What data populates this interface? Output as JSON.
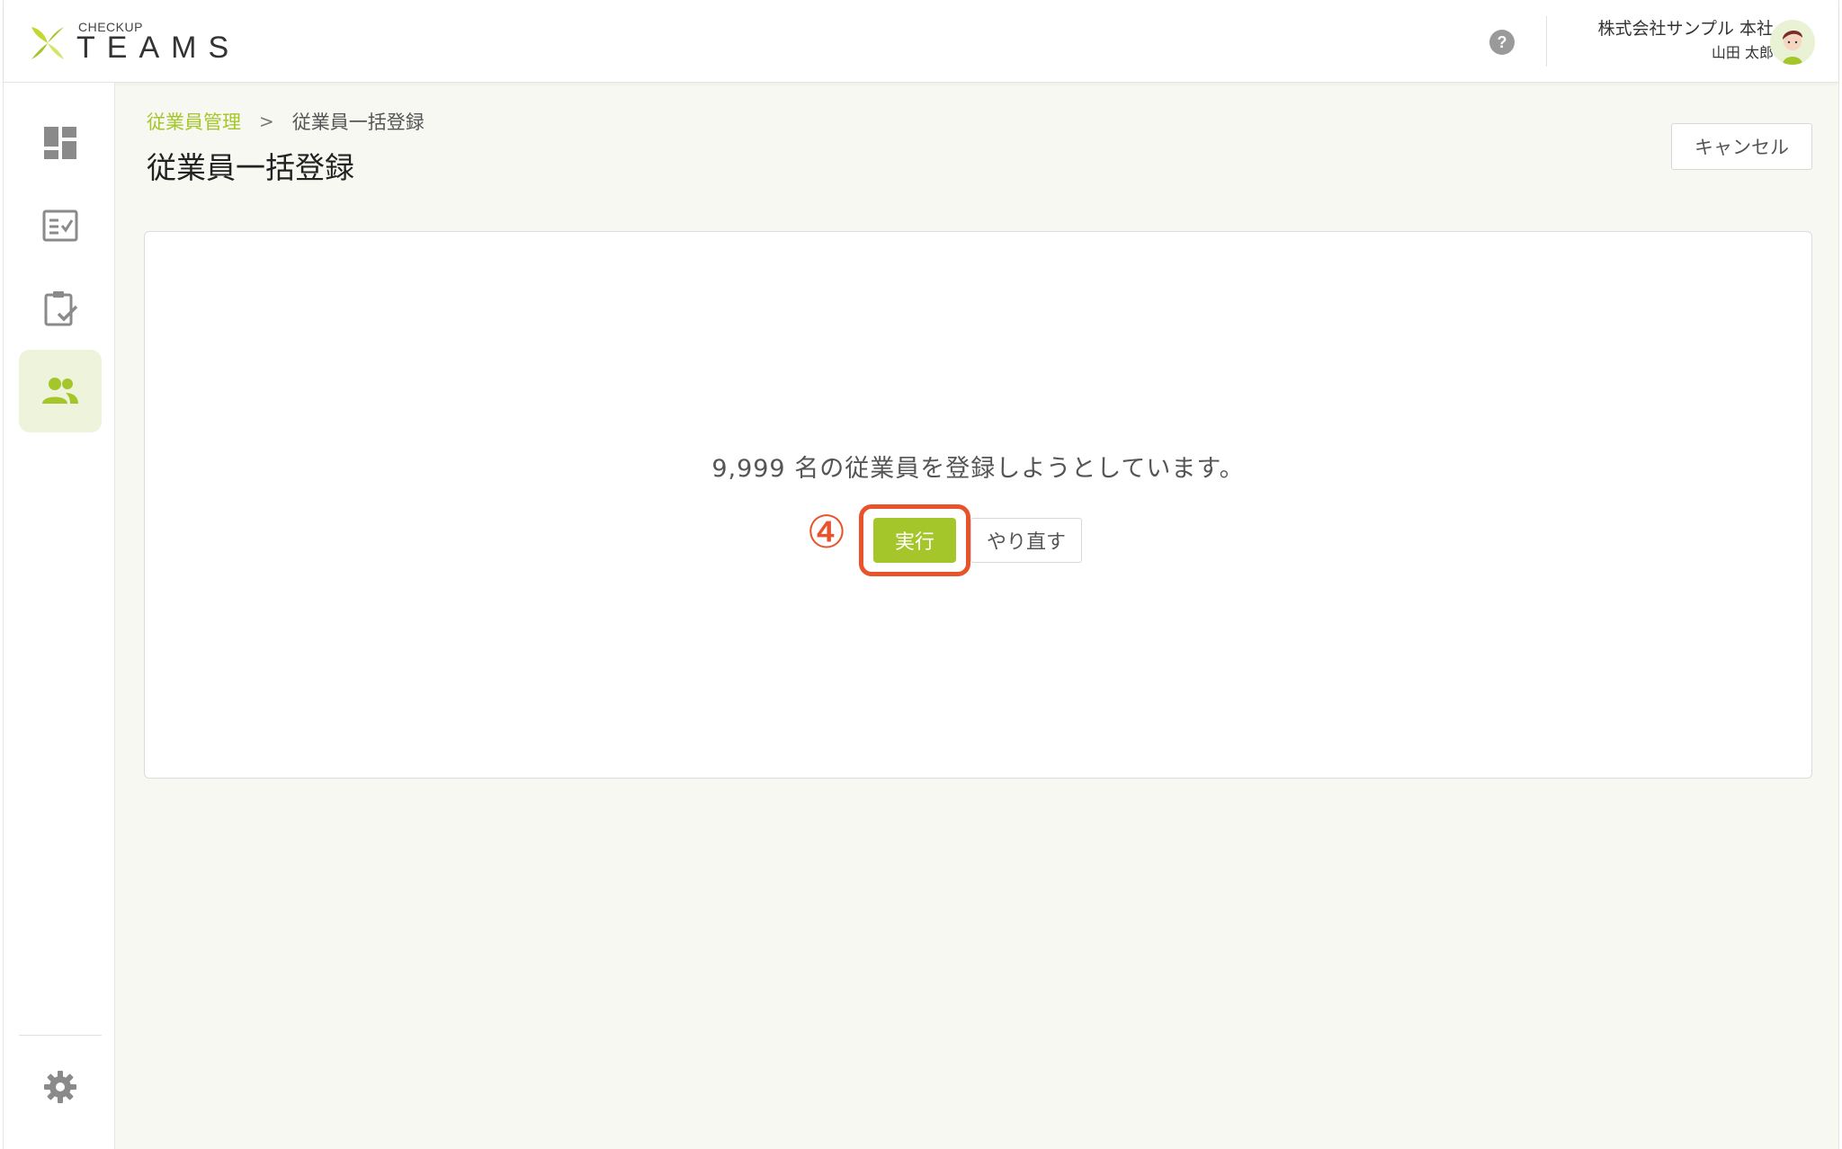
{
  "header": {
    "logo_small": "CHECKUP",
    "logo_big": "TEAMS",
    "company": "株式会社サンプル 本社",
    "user": "山田 太郎"
  },
  "sidebar": {
    "items": [
      {
        "name": "dashboard",
        "icon": "dashboard-icon",
        "active": false
      },
      {
        "name": "checklist",
        "icon": "checklist-icon",
        "active": false
      },
      {
        "name": "assignment",
        "icon": "clipboard-check-icon",
        "active": false
      },
      {
        "name": "employees",
        "icon": "people-icon",
        "active": true
      }
    ],
    "settings_icon": "gear-icon"
  },
  "breadcrumb": {
    "parent": "従業員管理",
    "separator": ">",
    "current": "従業員一括登録"
  },
  "page": {
    "title": "従業員一括登録",
    "cancel_label": "キャンセル"
  },
  "card": {
    "message": "9,999 名の従業員を登録しようとしています。",
    "step_marker": "④",
    "run_label": "実行",
    "redo_label": "やり直す"
  },
  "colors": {
    "accent": "#a5c62b",
    "highlight": "#e8532b",
    "background": "#f7f8f2"
  }
}
